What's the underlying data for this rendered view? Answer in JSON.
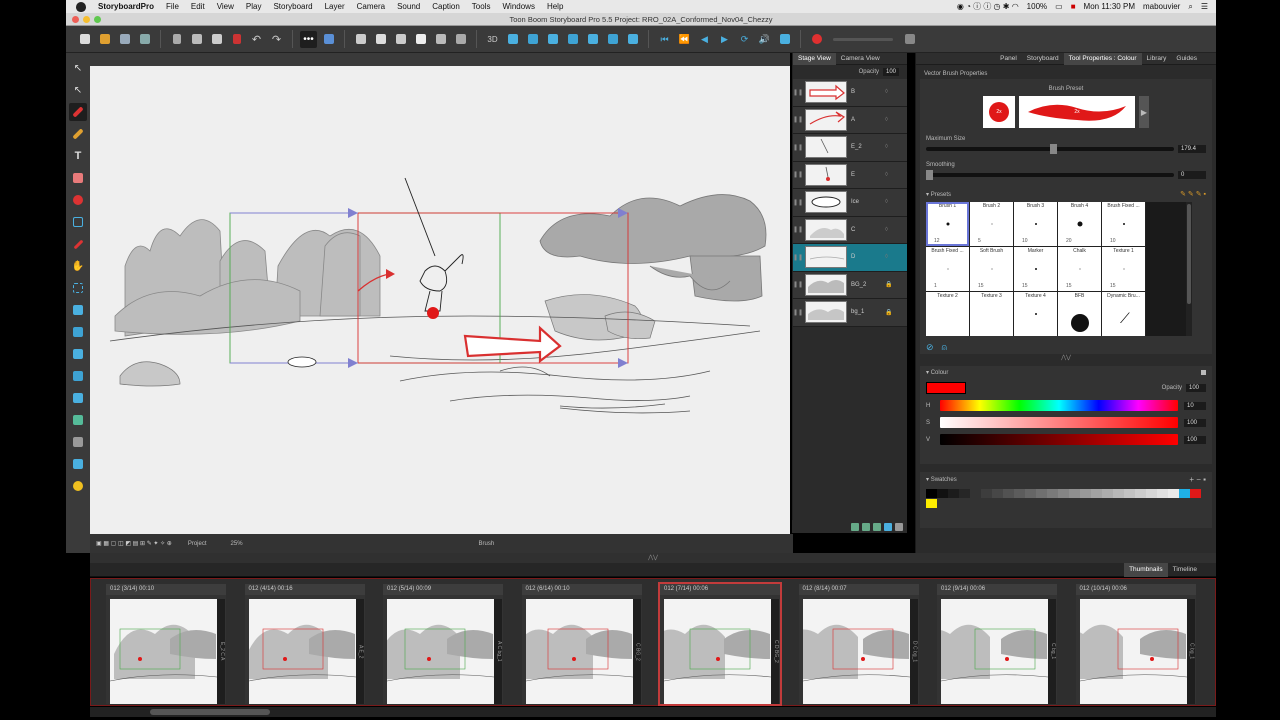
{
  "menubar": {
    "app_name": "StoryboardPro",
    "items": [
      "File",
      "Edit",
      "View",
      "Play",
      "Storyboard",
      "Layer",
      "Camera",
      "Sound",
      "Caption",
      "Tools",
      "Windows",
      "Help"
    ],
    "battery": "100%",
    "clock": "Mon 11:30 PM",
    "user": "mabouvier"
  },
  "titlebar": {
    "title": "Toon Boom Storyboard Pro 5.5 Project: RRO_02A_Conformed_Nov04_Chezzy"
  },
  "canvas_bottom": {
    "mode": "Project",
    "zoom": "25%",
    "tool": "Brush"
  },
  "stage": {
    "tabs": [
      "Stage View",
      "Camera View"
    ],
    "opacity_label": "Opacity",
    "opacity_value": "100",
    "layers": [
      {
        "name": "B",
        "locked": false
      },
      {
        "name": "A",
        "locked": false
      },
      {
        "name": "E_2",
        "locked": false
      },
      {
        "name": "E",
        "locked": false
      },
      {
        "name": "Ice",
        "locked": false
      },
      {
        "name": "C",
        "locked": false
      },
      {
        "name": "D",
        "locked": false,
        "active": true
      },
      {
        "name": "BG_2",
        "locked": true
      },
      {
        "name": "bg_1",
        "locked": true
      }
    ]
  },
  "props": {
    "tabs": [
      "Panel",
      "Storyboard",
      "Tool Properties : Colour",
      "Library",
      "Guides"
    ],
    "section_title": "Vector Brush Properties",
    "brush_preset_label": "Brush Preset",
    "brush_size_badge": "2x",
    "max_size_label": "Maximum Size",
    "max_size_value": "179.4",
    "max_size_level": 0.5,
    "smoothing_label": "Smoothing",
    "smoothing_value": "0",
    "smoothing_level": 0.0,
    "presets_label": "Presets",
    "presets": [
      {
        "name": "Brush 1",
        "size": "12"
      },
      {
        "name": "Brush 2",
        "size": "5"
      },
      {
        "name": "Brush 3",
        "size": "10"
      },
      {
        "name": "Brush 4",
        "size": "20"
      },
      {
        "name": "Brush Fixed ...",
        "size": "10"
      },
      {
        "name": "Brush Fixed ...",
        "size": "1"
      },
      {
        "name": "Soft Brush",
        "size": "15"
      },
      {
        "name": "Marker",
        "size": "15"
      },
      {
        "name": "Chalk",
        "size": "15"
      },
      {
        "name": "Texture 1",
        "size": "15"
      },
      {
        "name": "Texture 2",
        "size": ""
      },
      {
        "name": "Texture 3",
        "size": ""
      },
      {
        "name": "Texture 4",
        "size": ""
      },
      {
        "name": "BFB",
        "size": ""
      },
      {
        "name": "Dynamic Bru...",
        "size": ""
      }
    ],
    "colour_label": "Colour",
    "colour_swatch": "#ff0000",
    "opacity_label": "Opacity",
    "opacity_value": "100",
    "h_label": "H",
    "h_value": "10",
    "s_label": "S",
    "s_value": "100",
    "v_label": "V",
    "v_value": "100",
    "swatches_label": "Swatches"
  },
  "thumbnails": {
    "tabs": [
      "Thumbnails",
      "Timeline"
    ],
    "cards": [
      {
        "label": "012 (3/14) 00:10",
        "side": "E_2 C A"
      },
      {
        "label": "012 (4/14) 00:16",
        "side": "A E_2"
      },
      {
        "label": "012 (5/14) 00:09",
        "side": "A C bg_1"
      },
      {
        "label": "012 (6/14) 00:10",
        "side": "C BG_2"
      },
      {
        "label": "012 (7/14) 00:06",
        "side": "C D BG_2",
        "selected": true
      },
      {
        "label": "012 (8/14) 00:07",
        "side": "D C bg_1"
      },
      {
        "label": "012 (9/14) 00:06",
        "side": "C bg_1"
      },
      {
        "label": "012 (10/14) 00:06",
        "side": "C bg_1"
      }
    ]
  }
}
